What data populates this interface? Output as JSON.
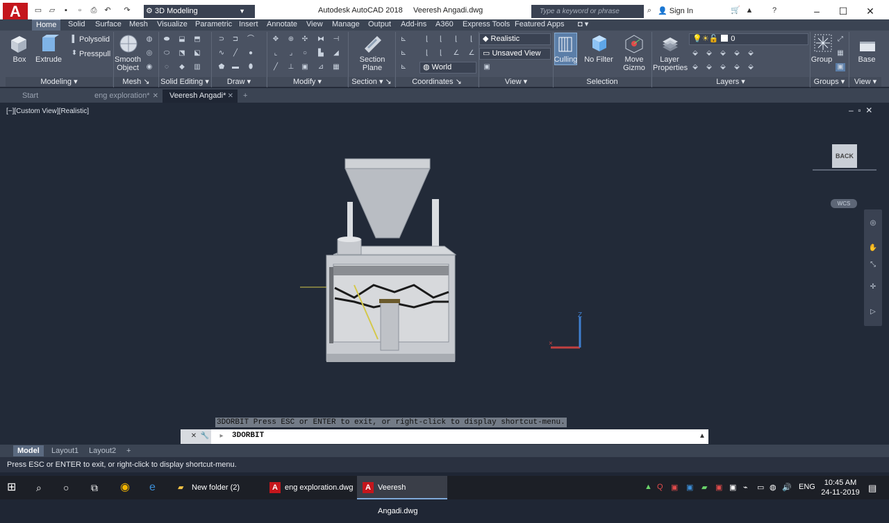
{
  "titlebar": {
    "workspace": "3D Modeling",
    "title": "Autodesk AutoCAD 2018",
    "filename": "Veeresh Angadi.dwg",
    "search_placeholder": "Type a keyword or phrase",
    "signin": "Sign In"
  },
  "ribbon_tabs": [
    "Home",
    "Solid",
    "Surface",
    "Mesh",
    "Visualize",
    "Parametric",
    "Insert",
    "Annotate",
    "View",
    "Manage",
    "Output",
    "Add-ins",
    "A360",
    "Express Tools",
    "Featured Apps"
  ],
  "ribbon": {
    "box": "Box",
    "extrude": "Extrude",
    "polysolid": "Polysolid",
    "presspull": "Presspull",
    "smooth_object_1": "Smooth",
    "smooth_object_2": "Object",
    "section_plane_1": "Section",
    "section_plane_2": "Plane",
    "visual_style": "Realistic",
    "view_select": "Unsaved View",
    "ucs_select": "World",
    "culling": "Culling",
    "no_filter": "No Filter",
    "move_gizmo_1": "Move",
    "move_gizmo_2": "Gizmo",
    "layer_properties_1": "Layer",
    "layer_properties_2": "Properties",
    "layer_select": "0",
    "group": "Group",
    "base": "Base",
    "panels": {
      "modeling": "Modeling",
      "mesh": "Mesh",
      "solid_editing": "Solid Editing",
      "draw": "Draw",
      "modify": "Modify",
      "section": "Section",
      "coordinates": "Coordinates",
      "view": "View",
      "selection": "Selection",
      "layers": "Layers",
      "groups": "Groups",
      "view2": "View"
    }
  },
  "doc_tabs": [
    "Start",
    "eng exploration*",
    "Veeresh Angadi*"
  ],
  "viewport": {
    "label": "[−][Custom View][Realistic]",
    "viewcube_face": "BACK",
    "wcs": "WCS",
    "axis_z": "Z"
  },
  "command": {
    "history": "3DORBIT Press ESC or ENTER to exit, or right-click to display shortcut-menu.",
    "current": "3DORBIT"
  },
  "layout_tabs": [
    "Model",
    "Layout1",
    "Layout2"
  ],
  "status_text": "Press ESC or ENTER to exit, or right-click to display shortcut-menu.",
  "taskbar": {
    "items": [
      "New folder (2)",
      "eng exploration.dwg",
      "Veeresh Angadi.dwg"
    ],
    "lang": "ENG",
    "time": "10:45 AM",
    "date": "24-11-2019"
  },
  "colors": {
    "accent": "#c4161c",
    "viewport_bg": "#222a38",
    "ribbon_bg": "#4a5262"
  }
}
